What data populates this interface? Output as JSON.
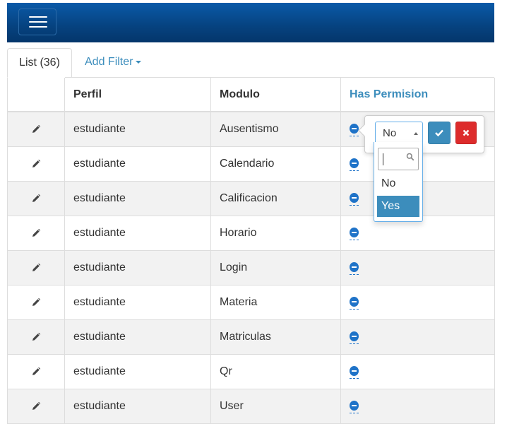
{
  "tabs": {
    "list_label": "List (36)",
    "filter_label": "Add Filter"
  },
  "table": {
    "columns": [
      "",
      "Perfil",
      "Modulo",
      "Has Permision"
    ],
    "rows": [
      {
        "perfil": "estudiante",
        "modulo": "Ausentismo"
      },
      {
        "perfil": "estudiante",
        "modulo": "Calendario"
      },
      {
        "perfil": "estudiante",
        "modulo": "Calificacion"
      },
      {
        "perfil": "estudiante",
        "modulo": "Horario"
      },
      {
        "perfil": "estudiante",
        "modulo": "Login"
      },
      {
        "perfil": "estudiante",
        "modulo": "Materia"
      },
      {
        "perfil": "estudiante",
        "modulo": "Matriculas"
      },
      {
        "perfil": "estudiante",
        "modulo": "Qr"
      },
      {
        "perfil": "estudiante",
        "modulo": "User"
      }
    ]
  },
  "editor": {
    "selected_value": "No",
    "options": [
      "No",
      "Yes"
    ],
    "highlighted_option": "Yes"
  },
  "colors": {
    "header_bar": "#06427f",
    "accent": "#3c8dbc",
    "cancel": "#dd2c2c",
    "row_alt": "#f2f2f2"
  },
  "icons": {
    "menu": "hamburger-icon",
    "edit": "pencil-icon",
    "permission": "minus-circle-icon",
    "confirm": "check-icon",
    "cancel": "times-icon",
    "search": "search-icon"
  }
}
